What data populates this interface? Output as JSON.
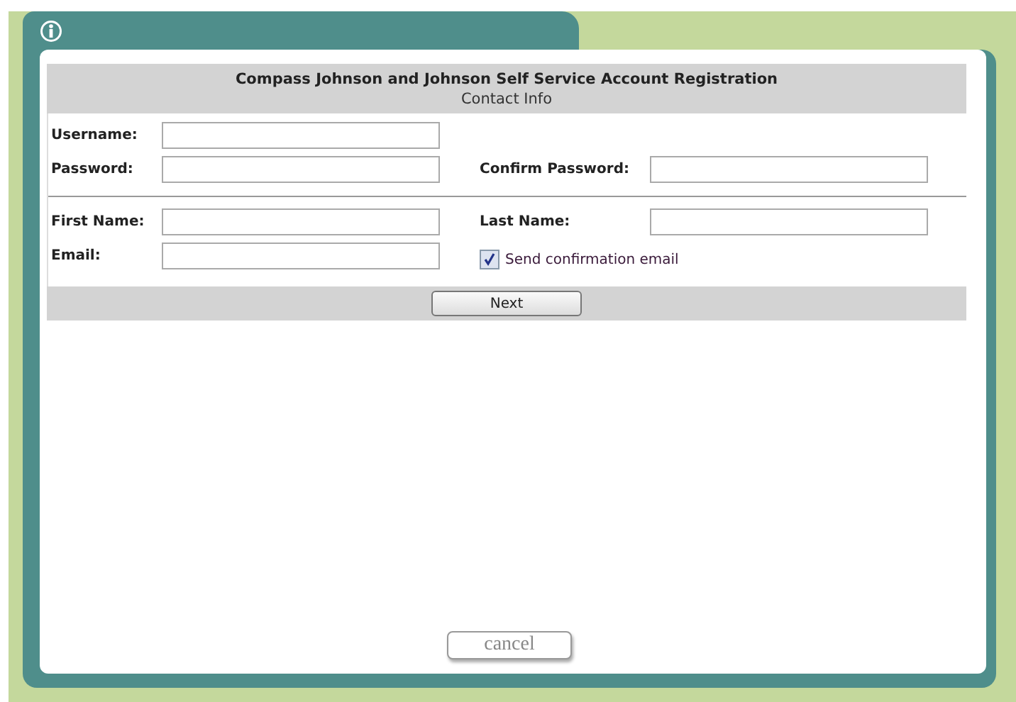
{
  "header": {
    "title": "Compass Johnson and Johnson Self Service Account Registration",
    "subtitle": "Contact Info"
  },
  "rows": [
    {
      "fields": [
        {
          "label": "Username:"
        }
      ]
    },
    {
      "fields": [
        {
          "label": "Password:"
        },
        {
          "label": "Confirm Password:"
        }
      ]
    },
    {
      "fields": [
        {
          "label": "First Name:"
        },
        {
          "label": "Last Name:"
        }
      ],
      "divider_above": true
    },
    {
      "fields": [
        {
          "label": "Email:"
        }
      ],
      "checkbox": {
        "label": "Send confirmation email",
        "checked": true
      }
    }
  ],
  "next_button": "Next",
  "cancel_button": "cancel"
}
